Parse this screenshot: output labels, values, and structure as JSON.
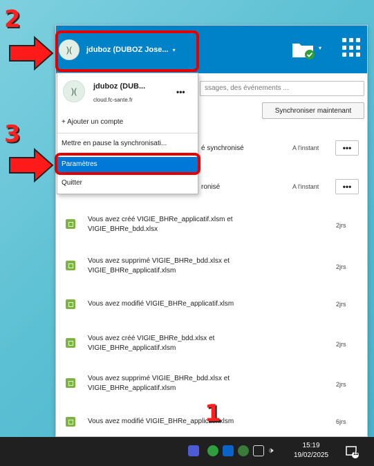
{
  "window": {
    "account_display": "jduboz (DUBOZ Jose...",
    "account_caret": "▾",
    "folder_caret": "▾",
    "search_placeholder": "ssages, des événements ...",
    "sync_button": "Synchroniser maintenant"
  },
  "menu": {
    "account_name": "jduboz (DUB...",
    "account_server": "cloud.fc-sante.fr",
    "account_more": "•••",
    "avatar_text": ")(",
    "add_account": "+  Ajouter un compte",
    "pause_sync": "Mettre en pause la synchronisati...",
    "settings": "Paramètres",
    "quit": "Quitter"
  },
  "activities": [
    {
      "text": "é synchronisé",
      "time": "A l'instant",
      "more": "•••"
    },
    {
      "text": "ronisé",
      "time": "A l'instant",
      "more": "•••"
    },
    {
      "text": "Vous avez créé VIGIE_BHRe_applicatif.xlsm et VIGIE_BHRe_bdd.xlsx",
      "time": "2jrs"
    },
    {
      "text": "Vous avez supprimé VIGIE_BHRe_bdd.xlsx et VIGIE_BHRe_applicatif.xlsm",
      "time": "2jrs"
    },
    {
      "text": "Vous avez modifié VIGIE_BHRe_applicatif.xlsm",
      "time": "2jrs"
    },
    {
      "text": "Vous avez créé VIGIE_BHRe_bdd.xlsx et VIGIE_BHRe_applicatif.xlsm",
      "time": "2jrs"
    },
    {
      "text": "Vous avez supprimé VIGIE_BHRe_bdd.xlsx et VIGIE_BHRe_applicatif.xlsm",
      "time": "2jrs"
    },
    {
      "text": "Vous avez modifié VIGIE_BHRe_applicatif.xlsm",
      "time": "6jrs"
    }
  ],
  "annotations": {
    "step1": "1",
    "step2": "2",
    "step3": "3",
    "color": "#e40000"
  },
  "taskbar": {
    "time": "15:19",
    "date": "19/02/2025",
    "notification_count": "11",
    "volume_glyph": "🕩"
  },
  "colors": {
    "header": "#0082c9",
    "selected": "#0078d7",
    "taskbar": "#202020"
  }
}
